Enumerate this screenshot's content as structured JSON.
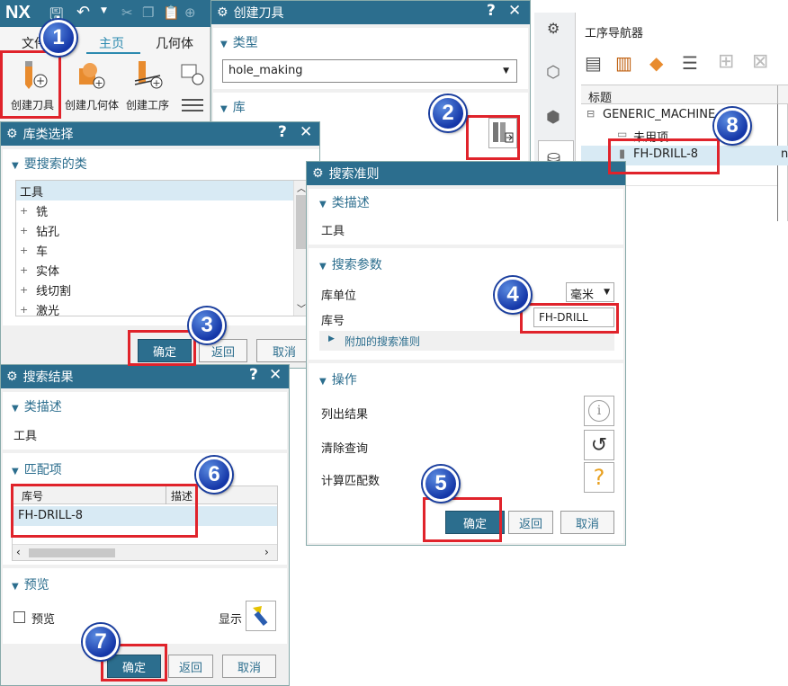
{
  "ribbon": {
    "logo": "NX",
    "tab_file": "文件",
    "tab_home": "主页",
    "tab_geometry": "几何体",
    "btn_create_tool": "创建刀具",
    "btn_create_geometry": "创建几何体",
    "btn_create_operation": "创建工序"
  },
  "create_tool": {
    "title": "创建刀具",
    "section_type": "类型",
    "type_value": "hole_making",
    "section_library": "库"
  },
  "navigator": {
    "title": "工序导航器",
    "col_title": "标题",
    "root": "GENERIC_MACHINE",
    "unused": "未用项",
    "tool": "FH-DRILL-8",
    "col_cut": "n"
  },
  "library_class": {
    "title": "库类选择",
    "section": "要搜索的类",
    "root": "工具",
    "items": [
      "铣",
      "钻孔",
      "车",
      "实体",
      "线切割",
      "激光"
    ],
    "ok": "确定",
    "back": "返回",
    "cancel": "取消"
  },
  "search_criteria": {
    "title": "搜索准则",
    "section_class": "类描述",
    "class_value": "工具",
    "section_params": "搜索参数",
    "unit_label": "库单位",
    "unit_value": "毫米",
    "libref_label": "库号",
    "libref_value": "FH-DRILL",
    "additional": "附加的搜索准则",
    "section_ops": "操作",
    "list_results": "列出结果",
    "clear_query": "清除查询",
    "calc_matches": "计算匹配数",
    "ok": "确定",
    "back": "返回",
    "cancel": "取消"
  },
  "search_results": {
    "title": "搜索结果",
    "section_class": "类描述",
    "class_value": "工具",
    "section_matches": "匹配项",
    "col_libref": "库号",
    "col_desc": "描述",
    "row1": "FH-DRILL-8",
    "section_preview": "预览",
    "preview_checkbox": "预览",
    "show_label": "显示",
    "ok": "确定",
    "back": "返回",
    "cancel": "取消"
  },
  "badges": [
    "1",
    "2",
    "3",
    "4",
    "5",
    "6",
    "7",
    "8"
  ],
  "colors": {
    "title_bar": "#2c6e8e",
    "highlight": "#e0232b",
    "badge": "#1537a8",
    "selection": "#d8eaf4"
  }
}
